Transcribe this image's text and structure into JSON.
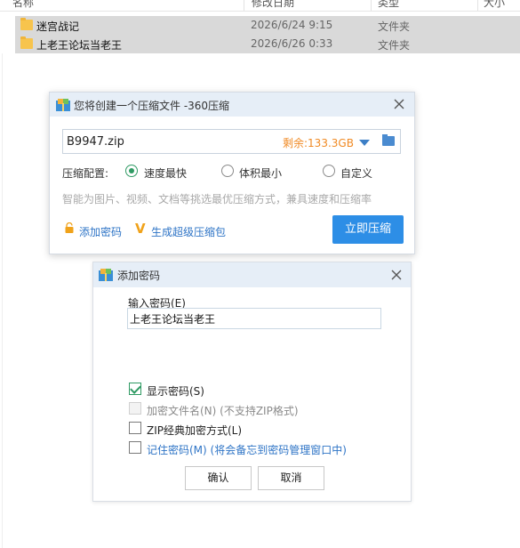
{
  "explorer": {
    "columns": [
      "名称",
      "修改日期",
      "类型",
      "大小"
    ],
    "files": [
      {
        "name": "迷宫战记",
        "date": "2026/6/24 9:15",
        "type": "文件夹",
        "icon": "folder-icon"
      },
      {
        "name": "上老王论坛当老王",
        "date": "2026/6/26 0:33",
        "type": "文件夹",
        "icon": "folder-icon"
      }
    ]
  },
  "compress_dialog": {
    "title": "您将创建一个压缩文件 -360压缩",
    "filename": "B9947.zip",
    "remaining": "剩余:133.3GB",
    "config_label": "压缩配置:",
    "options": [
      {
        "label": "速度最快",
        "selected": true
      },
      {
        "label": "体积最小",
        "selected": false
      },
      {
        "label": "自定义",
        "selected": false
      }
    ],
    "hint": "智能为图片、视频、文档等挑选最优压缩方式，兼具速度和压缩率",
    "add_password_link": "添加密码",
    "super_pack_link": "生成超级压缩包",
    "compress_button": "立即压缩"
  },
  "password_dialog": {
    "title": "添加密码",
    "input_label": "输入密码(E)",
    "password_value": "上老王论坛当老王",
    "checkboxes": [
      {
        "label": "显示密码(S)",
        "checked": true,
        "disabled": false
      },
      {
        "label": "加密文件名(N) (不支持ZIP格式)",
        "checked": false,
        "disabled": true
      },
      {
        "label": "ZIP经典加密方式(L)",
        "checked": false,
        "disabled": false
      },
      {
        "label": "记住密码(M) (将会备忘到密码管理窗口中)",
        "checked": false,
        "disabled": false
      }
    ],
    "ok_button": "确认",
    "cancel_button": "取消"
  },
  "colors": {
    "accent": "#2d8ee6",
    "link": "#2e74c6",
    "radio_green": "#2f9a63",
    "remaining_orange": "#f08a24",
    "titlebar": "#e6eef7",
    "selected_row": "#d9d9d9"
  }
}
